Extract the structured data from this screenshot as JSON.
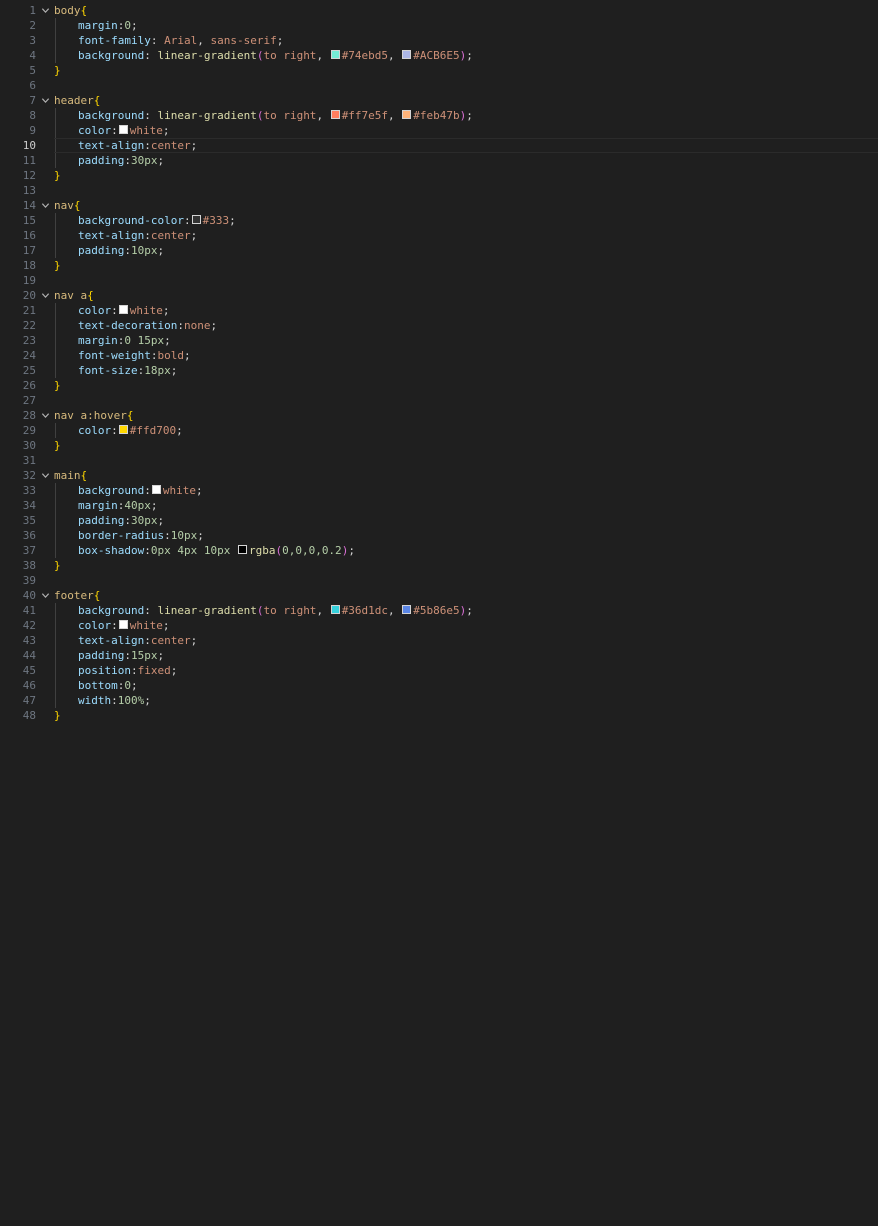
{
  "editor": {
    "active_line": 10,
    "lines": [
      {
        "n": 1,
        "fold": true,
        "indent": 0,
        "tokens": [
          {
            "t": "body",
            "c": "sel"
          },
          {
            "t": "{",
            "c": "brace"
          }
        ]
      },
      {
        "n": 2,
        "fold": false,
        "indent": 1,
        "tokens": [
          {
            "t": "margin",
            "c": "prop"
          },
          {
            "t": ":",
            "c": "punc"
          },
          {
            "t": "0",
            "c": "num"
          },
          {
            "t": ";",
            "c": "punc"
          }
        ]
      },
      {
        "n": 3,
        "fold": false,
        "indent": 1,
        "tokens": [
          {
            "t": "font-family",
            "c": "prop"
          },
          {
            "t": ": ",
            "c": "punc"
          },
          {
            "t": "Arial",
            "c": "val"
          },
          {
            "t": ", ",
            "c": "punc"
          },
          {
            "t": "sans-serif",
            "c": "val"
          },
          {
            "t": ";",
            "c": "punc"
          }
        ]
      },
      {
        "n": 4,
        "fold": false,
        "indent": 1,
        "tokens": [
          {
            "t": "background",
            "c": "prop"
          },
          {
            "t": ": ",
            "c": "punc"
          },
          {
            "t": "linear-gradient",
            "c": "fn"
          },
          {
            "t": "(",
            "c": "paren"
          },
          {
            "t": "to right",
            "c": "val"
          },
          {
            "t": ", ",
            "c": "punc"
          },
          {
            "sw": "#74ebd5"
          },
          {
            "t": "#74ebd5",
            "c": "val"
          },
          {
            "t": ", ",
            "c": "punc"
          },
          {
            "sw": "#ACB6E5"
          },
          {
            "t": "#ACB6E5",
            "c": "val"
          },
          {
            "t": ")",
            "c": "paren"
          },
          {
            "t": ";",
            "c": "punc"
          }
        ]
      },
      {
        "n": 5,
        "fold": false,
        "indent": 0,
        "tokens": [
          {
            "t": "}",
            "c": "brace"
          }
        ]
      },
      {
        "n": 6,
        "fold": false,
        "indent": 0,
        "tokens": []
      },
      {
        "n": 7,
        "fold": true,
        "indent": 0,
        "tokens": [
          {
            "t": "header",
            "c": "sel"
          },
          {
            "t": "{",
            "c": "brace"
          }
        ]
      },
      {
        "n": 8,
        "fold": false,
        "indent": 1,
        "tokens": [
          {
            "t": "background",
            "c": "prop"
          },
          {
            "t": ": ",
            "c": "punc"
          },
          {
            "t": "linear-gradient",
            "c": "fn"
          },
          {
            "t": "(",
            "c": "paren"
          },
          {
            "t": "to right",
            "c": "val"
          },
          {
            "t": ", ",
            "c": "punc"
          },
          {
            "sw": "#ff7e5f"
          },
          {
            "t": "#ff7e5f",
            "c": "val"
          },
          {
            "t": ", ",
            "c": "punc"
          },
          {
            "sw": "#feb47b"
          },
          {
            "t": "#feb47b",
            "c": "val"
          },
          {
            "t": ")",
            "c": "paren"
          },
          {
            "t": ";",
            "c": "punc"
          }
        ]
      },
      {
        "n": 9,
        "fold": false,
        "indent": 1,
        "tokens": [
          {
            "t": "color",
            "c": "prop"
          },
          {
            "t": ":",
            "c": "punc"
          },
          {
            "sw": "#ffffff"
          },
          {
            "t": "white",
            "c": "val"
          },
          {
            "t": ";",
            "c": "punc"
          }
        ]
      },
      {
        "n": 10,
        "fold": false,
        "indent": 1,
        "tokens": [
          {
            "t": "text-align",
            "c": "prop"
          },
          {
            "t": ":",
            "c": "punc"
          },
          {
            "t": "center",
            "c": "val"
          },
          {
            "t": ";",
            "c": "punc"
          }
        ]
      },
      {
        "n": 11,
        "fold": false,
        "indent": 1,
        "tokens": [
          {
            "t": "padding",
            "c": "prop"
          },
          {
            "t": ":",
            "c": "punc"
          },
          {
            "t": "30px",
            "c": "num"
          },
          {
            "t": ";",
            "c": "punc"
          }
        ]
      },
      {
        "n": 12,
        "fold": false,
        "indent": 0,
        "tokens": [
          {
            "t": "}",
            "c": "brace"
          }
        ]
      },
      {
        "n": 13,
        "fold": false,
        "indent": 0,
        "tokens": []
      },
      {
        "n": 14,
        "fold": true,
        "indent": 0,
        "tokens": [
          {
            "t": "nav",
            "c": "sel"
          },
          {
            "t": "{",
            "c": "brace"
          }
        ]
      },
      {
        "n": 15,
        "fold": false,
        "indent": 1,
        "tokens": [
          {
            "t": "background-color",
            "c": "prop"
          },
          {
            "t": ":",
            "c": "punc"
          },
          {
            "sw": "#333333"
          },
          {
            "t": "#333",
            "c": "val"
          },
          {
            "t": ";",
            "c": "punc"
          }
        ]
      },
      {
        "n": 16,
        "fold": false,
        "indent": 1,
        "tokens": [
          {
            "t": "text-align",
            "c": "prop"
          },
          {
            "t": ":",
            "c": "punc"
          },
          {
            "t": "center",
            "c": "val"
          },
          {
            "t": ";",
            "c": "punc"
          }
        ]
      },
      {
        "n": 17,
        "fold": false,
        "indent": 1,
        "tokens": [
          {
            "t": "padding",
            "c": "prop"
          },
          {
            "t": ":",
            "c": "punc"
          },
          {
            "t": "10px",
            "c": "num"
          },
          {
            "t": ";",
            "c": "punc"
          }
        ]
      },
      {
        "n": 18,
        "fold": false,
        "indent": 0,
        "tokens": [
          {
            "t": "}",
            "c": "brace"
          }
        ]
      },
      {
        "n": 19,
        "fold": false,
        "indent": 0,
        "tokens": []
      },
      {
        "n": 20,
        "fold": true,
        "indent": 0,
        "tokens": [
          {
            "t": "nav a",
            "c": "sel"
          },
          {
            "t": "{",
            "c": "brace"
          }
        ]
      },
      {
        "n": 21,
        "fold": false,
        "indent": 1,
        "tokens": [
          {
            "t": "color",
            "c": "prop"
          },
          {
            "t": ":",
            "c": "punc"
          },
          {
            "sw": "#ffffff"
          },
          {
            "t": "white",
            "c": "val"
          },
          {
            "t": ";",
            "c": "punc"
          }
        ]
      },
      {
        "n": 22,
        "fold": false,
        "indent": 1,
        "tokens": [
          {
            "t": "text-decoration",
            "c": "prop"
          },
          {
            "t": ":",
            "c": "punc"
          },
          {
            "t": "none",
            "c": "val"
          },
          {
            "t": ";",
            "c": "punc"
          }
        ]
      },
      {
        "n": 23,
        "fold": false,
        "indent": 1,
        "tokens": [
          {
            "t": "margin",
            "c": "prop"
          },
          {
            "t": ":",
            "c": "punc"
          },
          {
            "t": "0 15px",
            "c": "num"
          },
          {
            "t": ";",
            "c": "punc"
          }
        ]
      },
      {
        "n": 24,
        "fold": false,
        "indent": 1,
        "tokens": [
          {
            "t": "font-weight",
            "c": "prop"
          },
          {
            "t": ":",
            "c": "punc"
          },
          {
            "t": "bold",
            "c": "val"
          },
          {
            "t": ";",
            "c": "punc"
          }
        ]
      },
      {
        "n": 25,
        "fold": false,
        "indent": 1,
        "tokens": [
          {
            "t": "font-size",
            "c": "prop"
          },
          {
            "t": ":",
            "c": "punc"
          },
          {
            "t": "18px",
            "c": "num"
          },
          {
            "t": ";",
            "c": "punc"
          }
        ]
      },
      {
        "n": 26,
        "fold": false,
        "indent": 0,
        "tokens": [
          {
            "t": "}",
            "c": "brace"
          }
        ]
      },
      {
        "n": 27,
        "fold": false,
        "indent": 0,
        "tokens": []
      },
      {
        "n": 28,
        "fold": true,
        "indent": 0,
        "tokens": [
          {
            "t": "nav a:hover",
            "c": "sel"
          },
          {
            "t": "{",
            "c": "brace"
          }
        ]
      },
      {
        "n": 29,
        "fold": false,
        "indent": 1,
        "tokens": [
          {
            "t": "color",
            "c": "prop"
          },
          {
            "t": ":",
            "c": "punc"
          },
          {
            "sw": "#ffd700"
          },
          {
            "t": "#ffd700",
            "c": "val"
          },
          {
            "t": ";",
            "c": "punc"
          }
        ]
      },
      {
        "n": 30,
        "fold": false,
        "indent": 0,
        "tokens": [
          {
            "t": "}",
            "c": "brace"
          }
        ]
      },
      {
        "n": 31,
        "fold": false,
        "indent": 0,
        "tokens": []
      },
      {
        "n": 32,
        "fold": true,
        "indent": 0,
        "tokens": [
          {
            "t": "main",
            "c": "sel"
          },
          {
            "t": "{",
            "c": "brace"
          }
        ]
      },
      {
        "n": 33,
        "fold": false,
        "indent": 1,
        "tokens": [
          {
            "t": "background",
            "c": "prop"
          },
          {
            "t": ":",
            "c": "punc"
          },
          {
            "sw": "#ffffff"
          },
          {
            "t": "white",
            "c": "val"
          },
          {
            "t": ";",
            "c": "punc"
          }
        ]
      },
      {
        "n": 34,
        "fold": false,
        "indent": 1,
        "tokens": [
          {
            "t": "margin",
            "c": "prop"
          },
          {
            "t": ":",
            "c": "punc"
          },
          {
            "t": "40px",
            "c": "num"
          },
          {
            "t": ";",
            "c": "punc"
          }
        ]
      },
      {
        "n": 35,
        "fold": false,
        "indent": 1,
        "tokens": [
          {
            "t": "padding",
            "c": "prop"
          },
          {
            "t": ":",
            "c": "punc"
          },
          {
            "t": "30px",
            "c": "num"
          },
          {
            "t": ";",
            "c": "punc"
          }
        ]
      },
      {
        "n": 36,
        "fold": false,
        "indent": 1,
        "tokens": [
          {
            "t": "border-radius",
            "c": "prop"
          },
          {
            "t": ":",
            "c": "punc"
          },
          {
            "t": "10px",
            "c": "num"
          },
          {
            "t": ";",
            "c": "punc"
          }
        ]
      },
      {
        "n": 37,
        "fold": false,
        "indent": 1,
        "tokens": [
          {
            "t": "box-shadow",
            "c": "prop"
          },
          {
            "t": ":",
            "c": "punc"
          },
          {
            "t": "0px 4px 10px ",
            "c": "num"
          },
          {
            "sw": "#000000"
          },
          {
            "t": "rgba",
            "c": "fn"
          },
          {
            "t": "(",
            "c": "paren"
          },
          {
            "t": "0,0,0,0.2",
            "c": "num"
          },
          {
            "t": ")",
            "c": "paren"
          },
          {
            "t": ";",
            "c": "punc"
          }
        ]
      },
      {
        "n": 38,
        "fold": false,
        "indent": 0,
        "tokens": [
          {
            "t": "}",
            "c": "brace"
          }
        ]
      },
      {
        "n": 39,
        "fold": false,
        "indent": 0,
        "tokens": []
      },
      {
        "n": 40,
        "fold": true,
        "indent": 0,
        "tokens": [
          {
            "t": "footer",
            "c": "sel"
          },
          {
            "t": "{",
            "c": "brace"
          }
        ]
      },
      {
        "n": 41,
        "fold": false,
        "indent": 1,
        "tokens": [
          {
            "t": "background",
            "c": "prop"
          },
          {
            "t": ": ",
            "c": "punc"
          },
          {
            "t": "linear-gradient",
            "c": "fn"
          },
          {
            "t": "(",
            "c": "paren"
          },
          {
            "t": "to right",
            "c": "val"
          },
          {
            "t": ", ",
            "c": "punc"
          },
          {
            "sw": "#36d1dc"
          },
          {
            "t": "#36d1dc",
            "c": "val"
          },
          {
            "t": ", ",
            "c": "punc"
          },
          {
            "sw": "#5b86e5"
          },
          {
            "t": "#5b86e5",
            "c": "val"
          },
          {
            "t": ")",
            "c": "paren"
          },
          {
            "t": ";",
            "c": "punc"
          }
        ]
      },
      {
        "n": 42,
        "fold": false,
        "indent": 1,
        "tokens": [
          {
            "t": "color",
            "c": "prop"
          },
          {
            "t": ":",
            "c": "punc"
          },
          {
            "sw": "#ffffff"
          },
          {
            "t": "white",
            "c": "val"
          },
          {
            "t": ";",
            "c": "punc"
          }
        ]
      },
      {
        "n": 43,
        "fold": false,
        "indent": 1,
        "tokens": [
          {
            "t": "text-align",
            "c": "prop"
          },
          {
            "t": ":",
            "c": "punc"
          },
          {
            "t": "center",
            "c": "val"
          },
          {
            "t": ";",
            "c": "punc"
          }
        ]
      },
      {
        "n": 44,
        "fold": false,
        "indent": 1,
        "tokens": [
          {
            "t": "padding",
            "c": "prop"
          },
          {
            "t": ":",
            "c": "punc"
          },
          {
            "t": "15px",
            "c": "num"
          },
          {
            "t": ";",
            "c": "punc"
          }
        ]
      },
      {
        "n": 45,
        "fold": false,
        "indent": 1,
        "tokens": [
          {
            "t": "position",
            "c": "prop"
          },
          {
            "t": ":",
            "c": "punc"
          },
          {
            "t": "fixed",
            "c": "val"
          },
          {
            "t": ";",
            "c": "punc"
          }
        ]
      },
      {
        "n": 46,
        "fold": false,
        "indent": 1,
        "tokens": [
          {
            "t": "bottom",
            "c": "prop"
          },
          {
            "t": ":",
            "c": "punc"
          },
          {
            "t": "0",
            "c": "num"
          },
          {
            "t": ";",
            "c": "punc"
          }
        ]
      },
      {
        "n": 47,
        "fold": false,
        "indent": 1,
        "tokens": [
          {
            "t": "width",
            "c": "prop"
          },
          {
            "t": ":",
            "c": "punc"
          },
          {
            "t": "100%",
            "c": "num"
          },
          {
            "t": ";",
            "c": "punc"
          }
        ]
      },
      {
        "n": 48,
        "fold": false,
        "indent": 0,
        "tokens": [
          {
            "t": "}",
            "c": "brace"
          }
        ]
      }
    ]
  }
}
